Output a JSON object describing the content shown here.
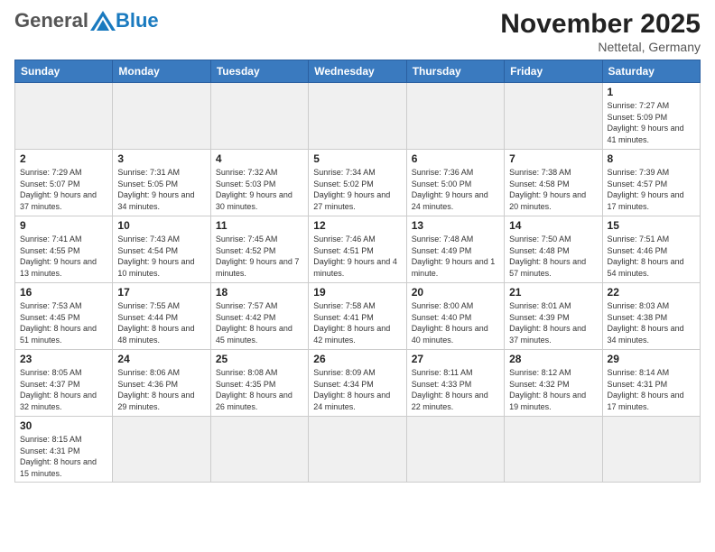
{
  "header": {
    "logo": {
      "general": "General",
      "blue": "Blue"
    },
    "title": "November 2025",
    "subtitle": "Nettetal, Germany"
  },
  "weekdays": [
    "Sunday",
    "Monday",
    "Tuesday",
    "Wednesday",
    "Thursday",
    "Friday",
    "Saturday"
  ],
  "weeks": [
    [
      {
        "day": "",
        "info": "",
        "empty": true
      },
      {
        "day": "",
        "info": "",
        "empty": true
      },
      {
        "day": "",
        "info": "",
        "empty": true
      },
      {
        "day": "",
        "info": "",
        "empty": true
      },
      {
        "day": "",
        "info": "",
        "empty": true
      },
      {
        "day": "",
        "info": "",
        "empty": true
      },
      {
        "day": "1",
        "info": "Sunrise: 7:27 AM\nSunset: 5:09 PM\nDaylight: 9 hours\nand 41 minutes."
      }
    ],
    [
      {
        "day": "2",
        "info": "Sunrise: 7:29 AM\nSunset: 5:07 PM\nDaylight: 9 hours\nand 37 minutes."
      },
      {
        "day": "3",
        "info": "Sunrise: 7:31 AM\nSunset: 5:05 PM\nDaylight: 9 hours\nand 34 minutes."
      },
      {
        "day": "4",
        "info": "Sunrise: 7:32 AM\nSunset: 5:03 PM\nDaylight: 9 hours\nand 30 minutes."
      },
      {
        "day": "5",
        "info": "Sunrise: 7:34 AM\nSunset: 5:02 PM\nDaylight: 9 hours\nand 27 minutes."
      },
      {
        "day": "6",
        "info": "Sunrise: 7:36 AM\nSunset: 5:00 PM\nDaylight: 9 hours\nand 24 minutes."
      },
      {
        "day": "7",
        "info": "Sunrise: 7:38 AM\nSunset: 4:58 PM\nDaylight: 9 hours\nand 20 minutes."
      },
      {
        "day": "8",
        "info": "Sunrise: 7:39 AM\nSunset: 4:57 PM\nDaylight: 9 hours\nand 17 minutes."
      }
    ],
    [
      {
        "day": "9",
        "info": "Sunrise: 7:41 AM\nSunset: 4:55 PM\nDaylight: 9 hours\nand 13 minutes."
      },
      {
        "day": "10",
        "info": "Sunrise: 7:43 AM\nSunset: 4:54 PM\nDaylight: 9 hours\nand 10 minutes."
      },
      {
        "day": "11",
        "info": "Sunrise: 7:45 AM\nSunset: 4:52 PM\nDaylight: 9 hours\nand 7 minutes."
      },
      {
        "day": "12",
        "info": "Sunrise: 7:46 AM\nSunset: 4:51 PM\nDaylight: 9 hours\nand 4 minutes."
      },
      {
        "day": "13",
        "info": "Sunrise: 7:48 AM\nSunset: 4:49 PM\nDaylight: 9 hours\nand 1 minute."
      },
      {
        "day": "14",
        "info": "Sunrise: 7:50 AM\nSunset: 4:48 PM\nDaylight: 8 hours\nand 57 minutes."
      },
      {
        "day": "15",
        "info": "Sunrise: 7:51 AM\nSunset: 4:46 PM\nDaylight: 8 hours\nand 54 minutes."
      }
    ],
    [
      {
        "day": "16",
        "info": "Sunrise: 7:53 AM\nSunset: 4:45 PM\nDaylight: 8 hours\nand 51 minutes."
      },
      {
        "day": "17",
        "info": "Sunrise: 7:55 AM\nSunset: 4:44 PM\nDaylight: 8 hours\nand 48 minutes."
      },
      {
        "day": "18",
        "info": "Sunrise: 7:57 AM\nSunset: 4:42 PM\nDaylight: 8 hours\nand 45 minutes."
      },
      {
        "day": "19",
        "info": "Sunrise: 7:58 AM\nSunset: 4:41 PM\nDaylight: 8 hours\nand 42 minutes."
      },
      {
        "day": "20",
        "info": "Sunrise: 8:00 AM\nSunset: 4:40 PM\nDaylight: 8 hours\nand 40 minutes."
      },
      {
        "day": "21",
        "info": "Sunrise: 8:01 AM\nSunset: 4:39 PM\nDaylight: 8 hours\nand 37 minutes."
      },
      {
        "day": "22",
        "info": "Sunrise: 8:03 AM\nSunset: 4:38 PM\nDaylight: 8 hours\nand 34 minutes."
      }
    ],
    [
      {
        "day": "23",
        "info": "Sunrise: 8:05 AM\nSunset: 4:37 PM\nDaylight: 8 hours\nand 32 minutes."
      },
      {
        "day": "24",
        "info": "Sunrise: 8:06 AM\nSunset: 4:36 PM\nDaylight: 8 hours\nand 29 minutes."
      },
      {
        "day": "25",
        "info": "Sunrise: 8:08 AM\nSunset: 4:35 PM\nDaylight: 8 hours\nand 26 minutes."
      },
      {
        "day": "26",
        "info": "Sunrise: 8:09 AM\nSunset: 4:34 PM\nDaylight: 8 hours\nand 24 minutes."
      },
      {
        "day": "27",
        "info": "Sunrise: 8:11 AM\nSunset: 4:33 PM\nDaylight: 8 hours\nand 22 minutes."
      },
      {
        "day": "28",
        "info": "Sunrise: 8:12 AM\nSunset: 4:32 PM\nDaylight: 8 hours\nand 19 minutes."
      },
      {
        "day": "29",
        "info": "Sunrise: 8:14 AM\nSunset: 4:31 PM\nDaylight: 8 hours\nand 17 minutes."
      }
    ],
    [
      {
        "day": "30",
        "info": "Sunrise: 8:15 AM\nSunset: 4:31 PM\nDaylight: 8 hours\nand 15 minutes."
      },
      {
        "day": "",
        "info": "",
        "empty": true
      },
      {
        "day": "",
        "info": "",
        "empty": true
      },
      {
        "day": "",
        "info": "",
        "empty": true
      },
      {
        "day": "",
        "info": "",
        "empty": true
      },
      {
        "day": "",
        "info": "",
        "empty": true
      },
      {
        "day": "",
        "info": "",
        "empty": true
      }
    ]
  ]
}
